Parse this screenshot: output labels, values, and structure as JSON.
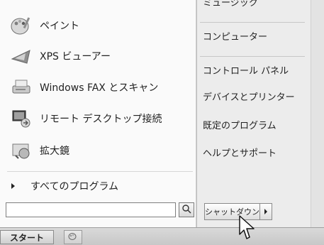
{
  "left_panel": {
    "programs": [
      {
        "label": "ペイント",
        "icon": "paint-icon"
      },
      {
        "label": "XPS ビューアー",
        "icon": "xps-viewer-icon"
      },
      {
        "label": "Windows FAX とスキャン",
        "icon": "fax-scan-icon"
      },
      {
        "label": "リモート デスクトップ接続",
        "icon": "remote-desktop-icon"
      },
      {
        "label": "拡大鏡",
        "icon": "magnifier-icon"
      }
    ],
    "all_programs_label": "すべてのプログラム",
    "search_placeholder": ""
  },
  "right_panel": {
    "items": [
      "ミュージック",
      "コンピューター",
      "コントロール パネル",
      "デバイスとプリンター",
      "既定のプログラム",
      "ヘルプとサポート"
    ],
    "shutdown_label": "シャットダウン"
  },
  "taskbar": {
    "start_label": "スタート"
  },
  "colors": {
    "accent": "#5a5a5a",
    "panel_left": "#fafafa",
    "panel_right": "#ececec"
  }
}
